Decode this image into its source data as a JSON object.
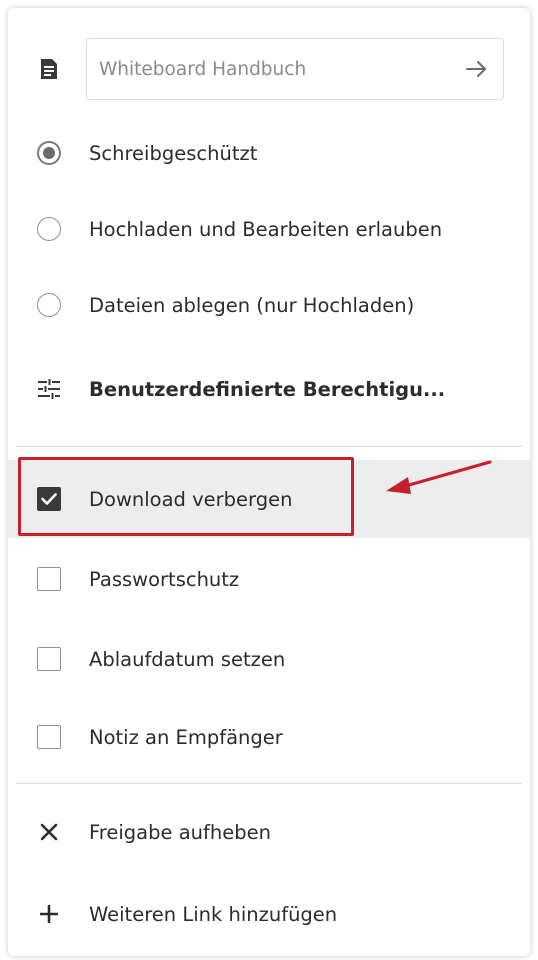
{
  "link_name_input": {
    "placeholder": "Whiteboard Handbuch",
    "icon": "arrow-right-icon"
  },
  "permissions": [
    {
      "label": "Schreibgeschützt",
      "selected": true
    },
    {
      "label": "Hochladen und Bearbeiten erlauben",
      "selected": false
    },
    {
      "label": "Dateien ablegen (nur Hochladen)",
      "selected": false
    }
  ],
  "custom_permissions": {
    "label": "Benutzerdefinierte Berechtigu...",
    "icon": "tune-icon"
  },
  "options": [
    {
      "label": "Download verbergen",
      "checked": true
    },
    {
      "label": "Passwortschutz",
      "checked": false
    },
    {
      "label": "Ablaufdatum setzen",
      "checked": false
    },
    {
      "label": "Notiz an Empfänger",
      "checked": false
    }
  ],
  "actions": {
    "unshare": {
      "label": "Freigabe aufheben",
      "icon": "close-icon"
    },
    "add_link": {
      "label": "Weiteren Link hinzufügen",
      "icon": "plus-icon"
    }
  },
  "colors": {
    "annotation": "#c8202b",
    "highlight_row": "#ededed",
    "checked_fill": "#3a3a3a"
  }
}
